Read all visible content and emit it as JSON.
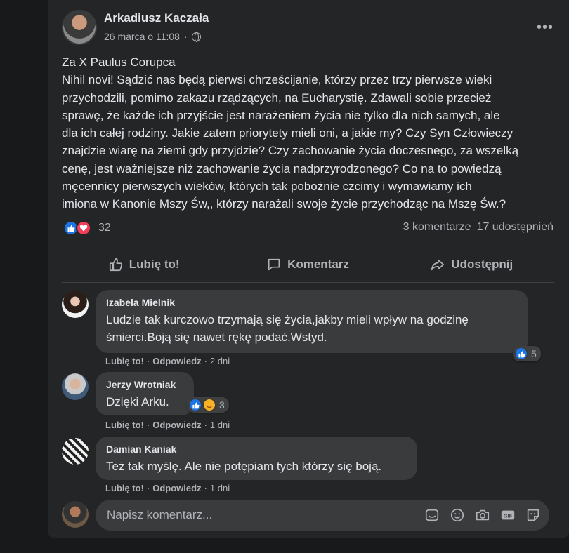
{
  "post": {
    "author": "Arkadiusz Kaczała",
    "timestamp": "26 marca o 11:08",
    "separator": "·",
    "body": "Za X Paulus Corupca\nNihil novi! Sądzić nas będą pierwsi chrześcijanie, którzy przez trzy pierwsze wieki\nprzychodzili, pomimo zakazu rządzących, na Eucharystię. Zdawali sobie przecież\nsprawę, że każde ich przyjście jest narażeniem życia nie tylko dla nich samych, ale\ndla ich całej rodziny. Jakie zatem priorytety mieli oni, a jakie my? Czy Syn Człowieczy\nznajdzie wiarę na ziemi gdy przyjdzie? Czy zachowanie życia doczesnego, za wszelką\ncenę, jest ważniejsze niż zachowanie życia nadprzyrodzonego? Co na to powiedzą\nmęcennicy pierwszych wieków, których tak pobożnie czcimy i wymawiamy ich\nimiona w Kanonie Mszy Św,, którzy narażali swoje życie przychodząc na Mszę Św.?",
    "reaction_count": "32",
    "comments_count": "3 komentarze",
    "shares_count": "17 udostępnień"
  },
  "actions": {
    "like": "Lubię to!",
    "comment": "Komentarz",
    "share": "Udostępnij"
  },
  "comments": [
    {
      "name": "Izabela Mielnik",
      "text": "Ludzie tak kurczowo trzymają się życia,jakby mieli wpływ na godzinę\nśmierci.Boją się nawet rękę podać.Wstyd.",
      "reactions": "5",
      "like": "Lubię to!",
      "reply": "Odpowiedz",
      "time": "2 dni"
    },
    {
      "name": "Jerzy Wrotniak",
      "text": "Dzięki Arku.",
      "reactions": "3",
      "like": "Lubię to!",
      "reply": "Odpowiedz",
      "time": "1 dni"
    },
    {
      "name": "Damian Kaniak",
      "text": "Też tak myślę. Ale nie potępiam tych którzy się boją.",
      "like": "Lubię to!",
      "reply": "Odpowiedz",
      "time": "1 dni"
    }
  ],
  "composer": {
    "placeholder": "Napisz komentarz..."
  },
  "colors": {
    "background": "#18191a",
    "card": "#242526",
    "bubble": "#3a3b3c",
    "like_blue": "#1b74e4",
    "love_red": "#f33e58"
  }
}
